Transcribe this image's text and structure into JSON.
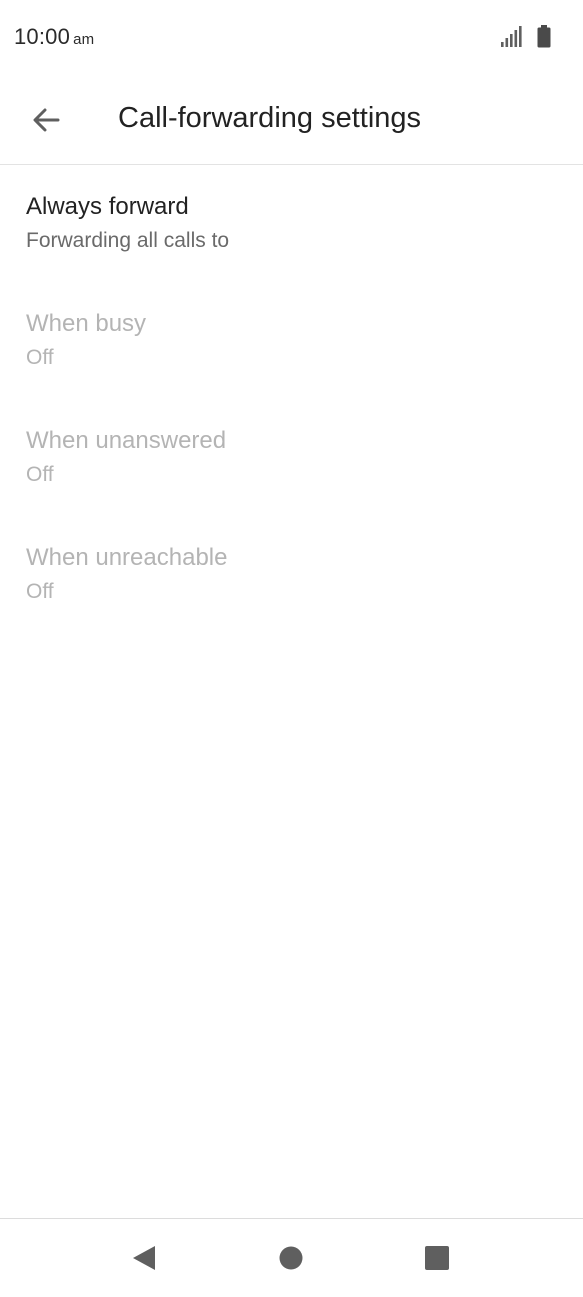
{
  "status_bar": {
    "time": "10:00",
    "ampm": "am",
    "icons": [
      "signal-icon",
      "battery-icon"
    ]
  },
  "app_bar": {
    "back_icon": "arrow-back-icon",
    "title": "Call-forwarding settings"
  },
  "preferences": [
    {
      "title": "Always forward",
      "summary": "Forwarding all calls to",
      "enabled": true
    },
    {
      "title": "When busy",
      "summary": "Off",
      "enabled": false
    },
    {
      "title": "When unanswered",
      "summary": "Off",
      "enabled": false
    },
    {
      "title": "When unreachable",
      "summary": "Off",
      "enabled": false
    }
  ],
  "nav_bar": {
    "buttons": [
      "nav-back-icon",
      "nav-home-icon",
      "nav-recents-icon"
    ]
  },
  "colors": {
    "text_primary": "#222222",
    "text_secondary": "#6a6a6a",
    "text_disabled": "#b4b4b4",
    "icon_gray": "#5f5f5f"
  }
}
